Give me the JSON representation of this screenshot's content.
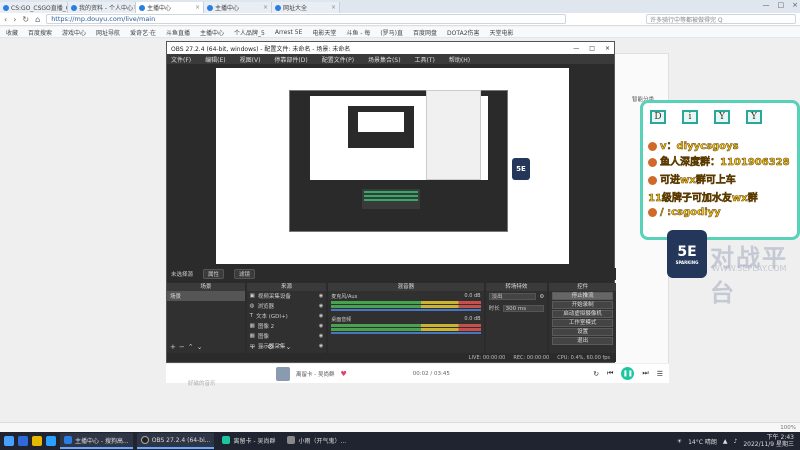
{
  "browser": {
    "tabs": [
      {
        "title": "CS:GO_CSGO直播_CS:",
        "active": false
      },
      {
        "title": "我的资料 - 个人中心",
        "active": false
      },
      {
        "title": "主播中心",
        "active": true
      },
      {
        "title": "主播中心",
        "active": false
      },
      {
        "title": "网址大全",
        "active": false
      }
    ],
    "url": "https://mp.douyu.com/live/main",
    "search_placeholder": "许多骑行中等都被做得完 Q",
    "bookmarks": [
      "收藏",
      "百度搜索",
      "游戏中心",
      "网址导航",
      "爱奇艺·在",
      "斗鱼直播",
      "主播中心",
      "个人品牌_5",
      "Arrest 5E",
      "电影天堂",
      "斗鱼 - 每",
      "(罗马)直",
      "百度网盘",
      "DOTA2伤害",
      "天堂电影"
    ],
    "status_left": "",
    "zoom": "100%"
  },
  "obs": {
    "title": "OBS 27.2.4 (64-bit, windows) - 配置文件: 未命名 - 场景: 未命名",
    "menu": [
      "文件(F)",
      "编辑(E)",
      "视图(V)",
      "停靠部件(D)",
      "配置文件(P)",
      "场景集合(S)",
      "工具(T)",
      "帮助(H)"
    ],
    "scene_bar": {
      "label": "未选择源",
      "props": "属性",
      "filters": "滤镜"
    },
    "docks": {
      "scenes": {
        "title": "场景",
        "items": [
          "场景"
        ]
      },
      "sources": {
        "title": "来源",
        "items": [
          "视频采集设备",
          "浏览器",
          "文本 (GDI+)",
          "图像 2",
          "图像",
          "显示器采集"
        ]
      },
      "mixer": {
        "title": "混音器",
        "channels": [
          {
            "name": "麦克风/Aux",
            "db": "0.0 dB"
          },
          {
            "name": "桌面音频",
            "db": "0.0 dB"
          }
        ]
      },
      "transitions": {
        "title": "转场特效",
        "type": "淡出",
        "duration_label": "时长",
        "duration": "300 ms"
      },
      "controls": {
        "title": "控件",
        "buttons": [
          "停止推流",
          "开始录制",
          "启动虚拟摄像机",
          "工作室模式",
          "设置",
          "退出"
        ]
      }
    },
    "status": {
      "live": "LIVE: 00:00:00",
      "rec": "REC: 00:00:00",
      "cpu": "CPU: 0.4%, 60.00 fps"
    }
  },
  "page": {
    "side_label": "智能分类",
    "left_faint": "好磁的音乐"
  },
  "player": {
    "song": "离留卡 - 吴尚群",
    "time": "00:02 / 03:45",
    "heart": "♥"
  },
  "overlay": {
    "letters": [
      "D",
      "i",
      "Y",
      "Y"
    ],
    "lines": [
      "v：diyycsgoys",
      "鱼人深度群：1101906328",
      "可进wx群可上车",
      "11级牌子可加水友wx群",
      "/ :csgodiyy"
    ],
    "logo": "5E",
    "logo_sub": "SPARKING",
    "watermark": "对战平台",
    "watermark_sub": "WWW.5EPLAY.COM"
  },
  "taskbar": {
    "tasks": [
      {
        "label": "主播中心 - 搜狗高...",
        "active": true
      },
      {
        "label": "OBS 27.2.4 (64-bi...",
        "active": true
      },
      {
        "label": "离留卡 - 吴尚群",
        "active": false
      },
      {
        "label": "小雨（开气鬼）...",
        "active": false
      }
    ],
    "weather": "14°C 晴朗",
    "time": "下午 2:43",
    "date": "2022/11/9 星期三"
  },
  "colors": {
    "accent": "#59d0b8",
    "obs_bg": "#2b2b2b",
    "play": "#1ec6a0",
    "overlay_text": "#f6c619"
  }
}
